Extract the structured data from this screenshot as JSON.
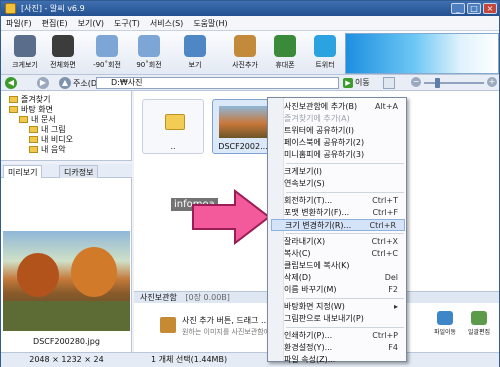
{
  "window": {
    "title": "[사진] - 알씨 v6.9"
  },
  "menubar": [
    "파일(F)",
    "편집(E)",
    "보기(V)",
    "도구(T)",
    "서비스(S)",
    "도움말(H)"
  ],
  "toolbar": [
    {
      "label": "크게보기",
      "icon": "magnifier-icon",
      "color": "#5a6e8c"
    },
    {
      "label": "전체화면",
      "icon": "fullscreen-icon",
      "color": "#3c3c3c"
    },
    {
      "label": "-90˚회전",
      "icon": "rotate-left-icon",
      "color": "#7da6d6"
    },
    {
      "label": "90˚회전",
      "icon": "rotate-right-icon",
      "color": "#7da6d6"
    },
    {
      "label": "보기",
      "icon": "view-grid-icon",
      "color": "#4f86c6"
    },
    {
      "label": "사진추가",
      "icon": "add-photo-icon",
      "color": "#c28a3a"
    },
    {
      "label": "휴대폰",
      "icon": "phone-icon",
      "color": "#3a8a3a"
    },
    {
      "label": "트위터",
      "icon": "twitter-icon",
      "color": "#2aa3e0"
    }
  ],
  "address": {
    "label": "주소(D)",
    "value": "D:₩사진",
    "go": "이동"
  },
  "tree": [
    {
      "label": "즐겨찾기"
    },
    {
      "label": "바탕 화면"
    },
    {
      "label": "내 문서"
    },
    {
      "label": "내 그림"
    },
    {
      "label": "내 비디오"
    },
    {
      "label": "내 음악"
    }
  ],
  "panel_tabs": [
    "미리보기",
    "디카정보"
  ],
  "preview": {
    "filename": "DSCF200280.jpg",
    "info": "2048 × 1232 × 24"
  },
  "thumbs": [
    {
      "caption": ".."
    },
    {
      "caption": "DSCF2002..."
    }
  ],
  "watermark": "infomoa",
  "basket": {
    "title": "사진보관함",
    "count": "[0장 0.00B]"
  },
  "basket_hint": {
    "line1": "사진 추가 버튼, 드래그 ...",
    "line2": "원하는 이미지를 사진보관함에 ..."
  },
  "basket_icons": [
    "파일이동",
    "일괄편집"
  ],
  "status": "1 개체 선택(1.44MB)",
  "context_menu": [
    {
      "label": "사진보관함에 추가(B)",
      "shortcut": "Alt+A"
    },
    {
      "label": "즐겨찾기에 추가(A)",
      "shortcut": "",
      "disabled": true
    },
    {
      "label": "트위터에 공유하기(I)",
      "shortcut": ""
    },
    {
      "label": "페이스북에 공유하기(2)",
      "shortcut": ""
    },
    {
      "label": "미니홈피에 공유하기(3)",
      "shortcut": ""
    },
    {
      "sep": true
    },
    {
      "label": "크게보기(I)",
      "shortcut": ""
    },
    {
      "label": "연속보기(S)",
      "shortcut": ""
    },
    {
      "sep": true
    },
    {
      "label": "회전하기(T)...",
      "shortcut": "Ctrl+T"
    },
    {
      "label": "포맷 변환하기(F)...",
      "shortcut": "Ctrl+F"
    },
    {
      "label": "크기 변경하기(R)...",
      "shortcut": "Ctrl+R",
      "highlight": true
    },
    {
      "sep": true
    },
    {
      "label": "잘라내기(X)",
      "shortcut": "Ctrl+X"
    },
    {
      "label": "복사(C)",
      "shortcut": "Ctrl+C"
    },
    {
      "label": "클립보드에 복사(K)",
      "shortcut": ""
    },
    {
      "label": "삭제(D)",
      "shortcut": "Del"
    },
    {
      "label": "이름 바꾸기(M)",
      "shortcut": "F2"
    },
    {
      "sep": true
    },
    {
      "label": "바탕화면 지정(W)",
      "shortcut": "▸"
    },
    {
      "label": "그림판으로 내보내기(P)",
      "shortcut": ""
    },
    {
      "sep": true
    },
    {
      "label": "인쇄하기(P)...",
      "shortcut": "Ctrl+P"
    },
    {
      "label": "환경설정(Y)...",
      "shortcut": "F4"
    },
    {
      "label": "파일 속성(Z)...",
      "shortcut": ""
    }
  ]
}
